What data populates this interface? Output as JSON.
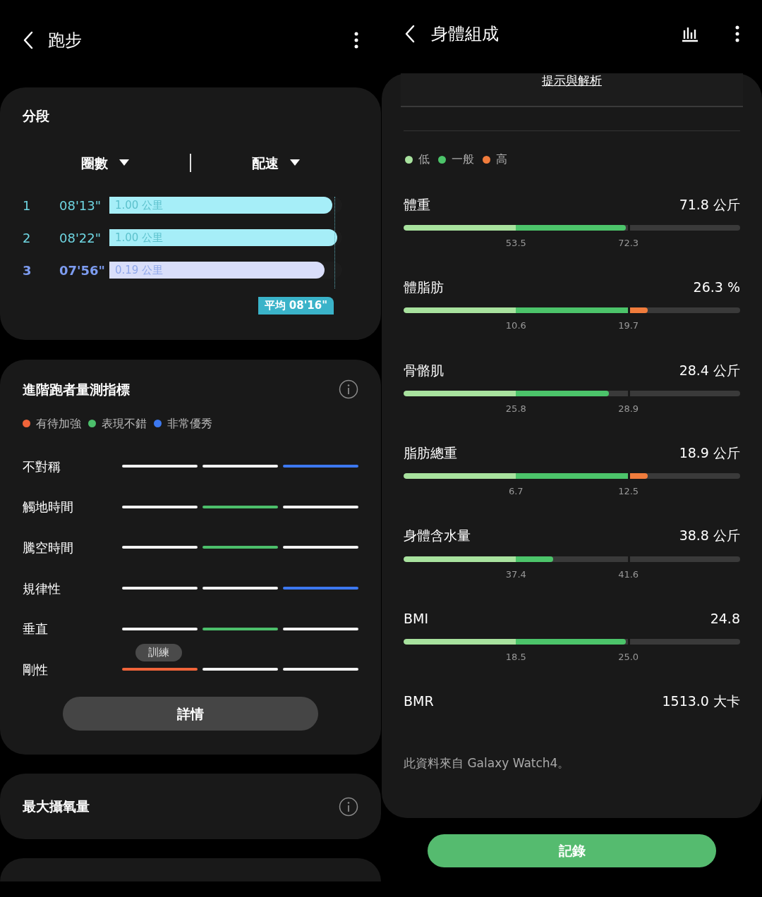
{
  "left": {
    "header": {
      "title": "跑步"
    },
    "splits": {
      "title": "分段",
      "selectors": [
        {
          "label": "圈數"
        },
        {
          "label": "配速"
        }
      ],
      "rows": [
        {
          "lap": "1",
          "pace": "08'13\"",
          "distance": "1.00 公里",
          "level": 0.958,
          "selected": false
        },
        {
          "lap": "2",
          "pace": "08'22\"",
          "distance": "1.00 公里",
          "level": 0.979,
          "selected": false
        },
        {
          "lap": "3",
          "pace": "07'56\"",
          "distance": "0.19 公里",
          "level": 0.924,
          "selected": true
        }
      ],
      "average": "平均 08'16\""
    },
    "metrics": {
      "title": "進階跑者量測指標",
      "legend": [
        {
          "label": "有待加強",
          "color": "#f0643a"
        },
        {
          "label": "表現不錯",
          "color": "#4cbf6b"
        },
        {
          "label": "非常優秀",
          "color": "#3c78f0"
        }
      ],
      "rows": [
        {
          "name": "不對稱",
          "segments": [
            {
              "color": "#f2f2f2"
            },
            {
              "color": "#f2f2f2"
            },
            {
              "color": "#3c78f0"
            }
          ]
        },
        {
          "name": "觸地時間",
          "segments": [
            {
              "color": "#f2f2f2"
            },
            {
              "color": "#4cbf6b"
            },
            {
              "color": "#f2f2f2"
            }
          ]
        },
        {
          "name": "騰空時間",
          "segments": [
            {
              "color": "#f2f2f2"
            },
            {
              "color": "#4cbf6b"
            },
            {
              "color": "#f2f2f2"
            }
          ]
        },
        {
          "name": "規律性",
          "segments": [
            {
              "color": "#f2f2f2"
            },
            {
              "color": "#f2f2f2"
            },
            {
              "color": "#3c78f0"
            }
          ]
        },
        {
          "name": "垂直",
          "segments": [
            {
              "color": "#f2f2f2"
            },
            {
              "color": "#4cbf6b"
            },
            {
              "color": "#f2f2f2"
            }
          ]
        },
        {
          "name": "剛性",
          "segments": [
            {
              "color": "#f0643a",
              "tooltip": "訓練"
            },
            {
              "color": "#f2f2f2"
            },
            {
              "color": "#f2f2f2"
            }
          ]
        }
      ],
      "button": "詳情"
    },
    "vo2": {
      "title": "最大攝氧量"
    }
  },
  "right": {
    "header": {
      "title": "身體組成"
    },
    "tips_link": "提示與解析",
    "legend": [
      {
        "label": "低",
        "color": "#a8e29e"
      },
      {
        "label": "一般",
        "color": "#4cc46a"
      },
      {
        "label": "高",
        "color": "#f07c3c"
      }
    ],
    "items": [
      {
        "name": "體重",
        "value": "71.8 公斤",
        "level": 0.66,
        "ticks": [
          "53.5",
          "72.3"
        ]
      },
      {
        "name": "體脂肪",
        "value": "26.3 %",
        "level": 0.725,
        "ticks": [
          "10.6",
          "19.7"
        ]
      },
      {
        "name": "骨骼肌",
        "value": "28.4 公斤",
        "level": 0.61,
        "ticks": [
          "25.8",
          "28.9"
        ]
      },
      {
        "name": "脂肪總重",
        "value": "18.9 公斤",
        "level": 0.725,
        "ticks": [
          "6.7",
          "12.5"
        ]
      },
      {
        "name": "身體含水量",
        "value": "38.8 公斤",
        "level": 0.445,
        "ticks": [
          "37.4",
          "41.6"
        ]
      },
      {
        "name": "BMI",
        "value": "24.8",
        "level": 0.66,
        "ticks": [
          "18.5",
          "25.0"
        ]
      },
      {
        "name": "BMR",
        "value": "1513.0 大卡"
      }
    ],
    "source_note": "此資料來自 Galaxy Watch4。",
    "record_button": "記錄"
  }
}
